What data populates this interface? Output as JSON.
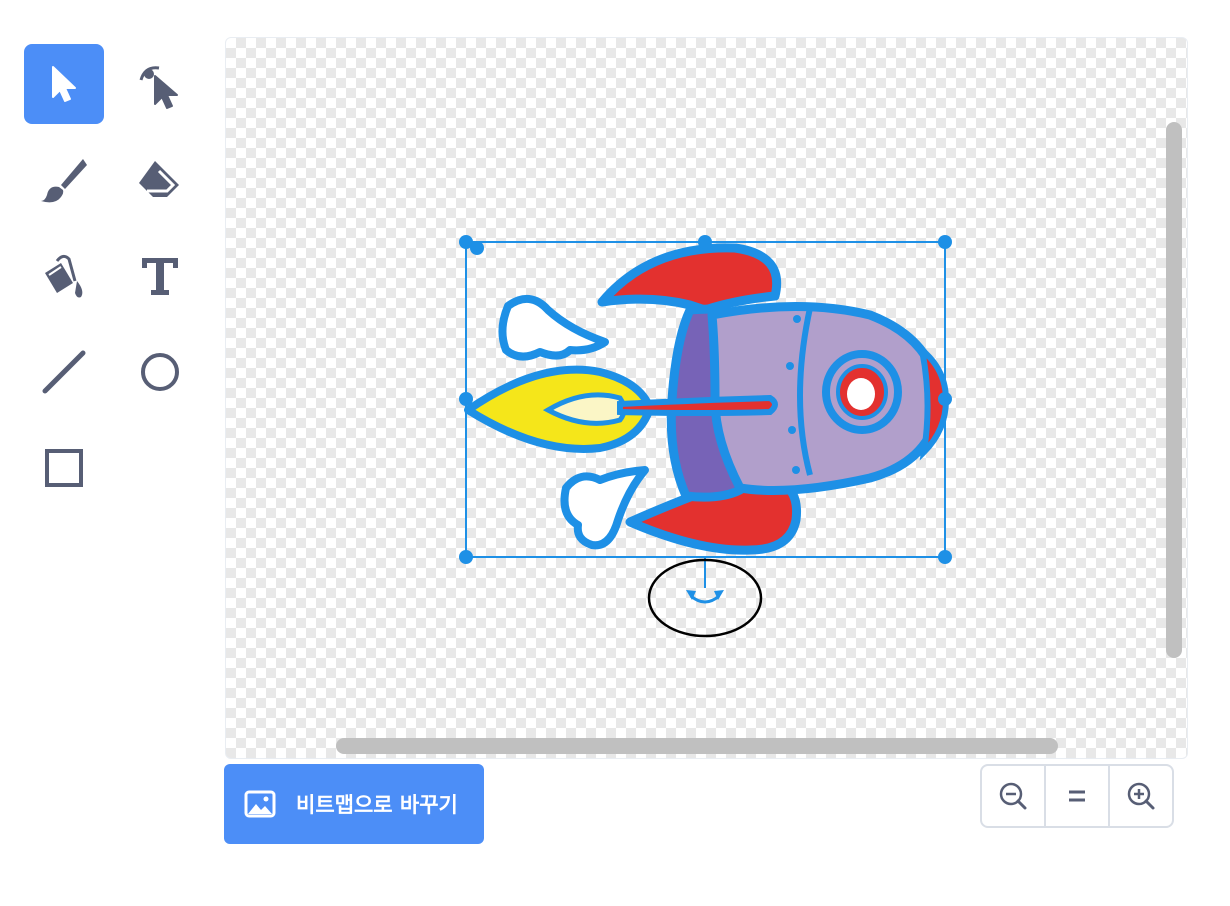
{
  "tools": {
    "select": {
      "icon": "select-arrow-icon",
      "active": true
    },
    "reshape": {
      "icon": "reshape-icon"
    },
    "brush": {
      "icon": "brush-icon"
    },
    "eraser": {
      "icon": "eraser-icon"
    },
    "fill": {
      "icon": "paint-bucket-icon"
    },
    "text": {
      "icon": "text-icon",
      "glyph": "T"
    },
    "line": {
      "icon": "line-icon"
    },
    "circle": {
      "icon": "circle-icon"
    },
    "rectangle": {
      "icon": "rectangle-icon"
    }
  },
  "convert_button": {
    "label": "비트맵으로 바꾸기",
    "icon": "image-icon"
  },
  "zoom": {
    "zoom_out": {
      "icon": "zoom-out-icon"
    },
    "reset": {
      "icon": "zoom-reset-icon",
      "glyph": "="
    },
    "zoom_in": {
      "icon": "zoom-in-icon"
    }
  },
  "colors": {
    "accent": "#4c8ef7",
    "selection": "#1e90e6",
    "icon": "#575e75",
    "rocket_body": "#b19fcb",
    "rocket_fin": "#e3312f",
    "flame": "#f5e61a"
  }
}
